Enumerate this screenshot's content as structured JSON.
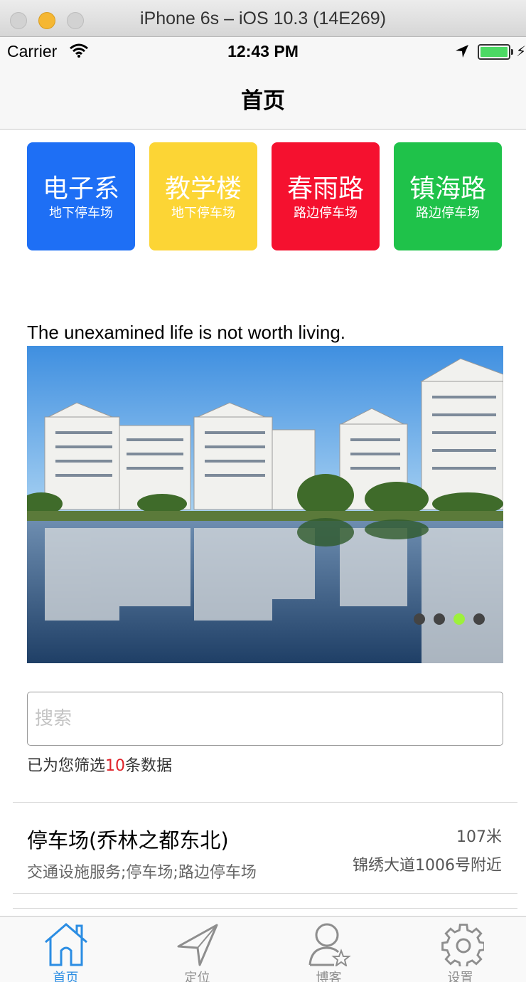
{
  "simulator": {
    "title": "iPhone 6s – iOS 10.3 (14E269)"
  },
  "status_bar": {
    "carrier": "Carrier",
    "time": "12:43 PM"
  },
  "nav": {
    "title": "首页"
  },
  "tiles": [
    {
      "title": "电子系",
      "subtitle": "地下停车场",
      "color": "#1e6ff5"
    },
    {
      "title": "教学楼",
      "subtitle": "地下停车场",
      "color": "#fcd535"
    },
    {
      "title": "春雨路",
      "subtitle": "路边停车场",
      "color": "#f5112f"
    },
    {
      "title": "镇海路",
      "subtitle": "路边停车场",
      "color": "#1fc24a"
    }
  ],
  "quote": "The unexamined life is not worth living.",
  "banner": {
    "page_count": 4,
    "active_page": 3
  },
  "search": {
    "placeholder": "搜索",
    "value": ""
  },
  "filter_note": {
    "prefix": "已为您筛选",
    "count": "10",
    "suffix": "条数据"
  },
  "list": [
    {
      "name": "停车场(乔林之都东北)",
      "category": "交通设施服务;停车场;路边停车场",
      "distance": "107米",
      "address": "锦绣大道1006号附近"
    }
  ],
  "tabbar": {
    "items": [
      {
        "label": "首页",
        "icon": "home-icon",
        "active": true
      },
      {
        "label": "定位",
        "icon": "location-icon",
        "active": false
      },
      {
        "label": "博客",
        "icon": "user-star-icon",
        "active": false
      },
      {
        "label": "设置",
        "icon": "gear-icon",
        "active": false
      }
    ],
    "active_color": "#2b8de3",
    "inactive_color": "#8e8e8e"
  }
}
